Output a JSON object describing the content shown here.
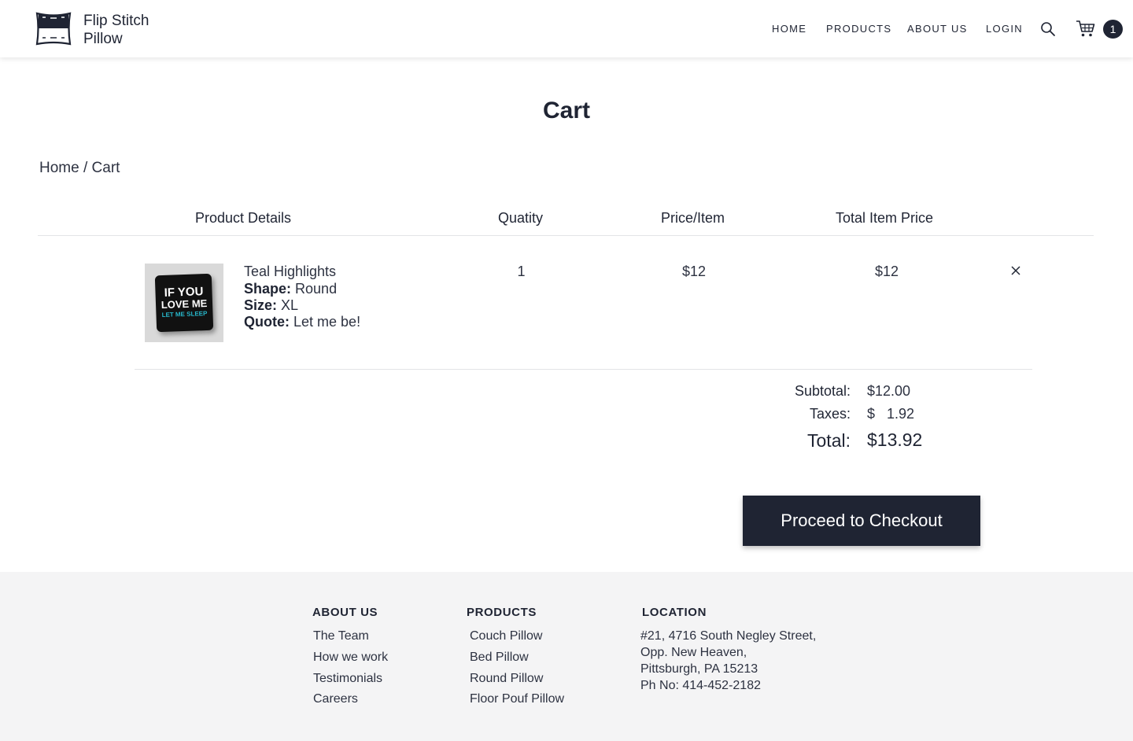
{
  "header": {
    "brand_line1": "Flip Stitch",
    "brand_line2": "Pillow",
    "nav": {
      "home": "HOME",
      "products": "PRODUCTS",
      "about": "ABOUT US",
      "login": "LOGIN"
    },
    "cart_count": "1",
    "icons": {
      "search": "search-icon",
      "cart": "cart-icon",
      "logo": "pillow-logo-icon"
    }
  },
  "page": {
    "title": "Cart",
    "breadcrumb": {
      "home": "Home",
      "sep": " / ",
      "current": "Cart"
    }
  },
  "table": {
    "headers": {
      "product": "Product Details",
      "quantity": "Quatity",
      "price": "Price/Item",
      "total": "Total Item Price"
    },
    "item": {
      "name": "Teal Highlights",
      "shape_label": "Shape:",
      "shape": "Round",
      "size_label": "Size:",
      "size": "XL",
      "quote_label": "Quote:",
      "quote": "Let me be!",
      "qty": "1",
      "price": "$12",
      "total": "$12",
      "image_text": {
        "line1": "IF YOU",
        "line2": "LOVE ME",
        "line3": "LET ME SLEEP"
      }
    }
  },
  "summary": {
    "subtotal_label": "Subtotal:",
    "subtotal": "$12.00",
    "taxes_label": "Taxes:",
    "taxes": "$   1.92",
    "total_label": "Total:",
    "total": "$13.92"
  },
  "checkout_label": "Proceed to Checkout",
  "footer": {
    "about_heading": "ABOUT US",
    "about_links": [
      "The Team",
      "How we work",
      "Testimonials",
      "Careers"
    ],
    "products_heading": "PRODUCTS",
    "products_links": [
      "Couch Pillow",
      "Bed Pillow",
      "Round Pillow",
      "Floor Pouf Pillow"
    ],
    "location_heading": "LOCATION",
    "address_lines": [
      "#21, 4716 South Negley Street,",
      "Opp. New Heaven,",
      "Pittsburgh, PA 15213",
      "Ph No: 414-452-2182"
    ]
  },
  "colors": {
    "navy": "#1f2433",
    "footer_bg": "#f4f4f5",
    "teal": "#27b6c9"
  }
}
